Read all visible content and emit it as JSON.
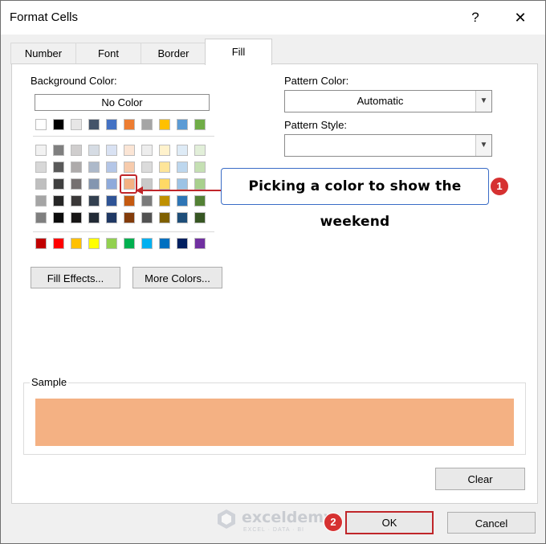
{
  "dialog": {
    "title": "Format Cells",
    "help_label": "?",
    "close_label": "✕"
  },
  "tabs": [
    {
      "label": "Number",
      "active": false
    },
    {
      "label": "Font",
      "active": false
    },
    {
      "label": "Border",
      "active": false
    },
    {
      "label": "Fill",
      "active": true
    }
  ],
  "fill": {
    "background_color_label": "Background Color:",
    "no_color_label": "No Color",
    "theme_top_row": [
      "#ffffff",
      "#000000",
      "#e7e6e6",
      "#44546a",
      "#4472c4",
      "#ed7d31",
      "#a5a5a5",
      "#ffc000",
      "#5b9bd5",
      "#70ad47"
    ],
    "theme_shades": [
      [
        "#f2f2f2",
        "#7f7f7f",
        "#d0cece",
        "#d6dce4",
        "#d9e2f3",
        "#fbe5d5",
        "#ededed",
        "#fff2cc",
        "#deebf6",
        "#e2efd9"
      ],
      [
        "#d8d8d8",
        "#595959",
        "#aeabab",
        "#adb9ca",
        "#b4c6e7",
        "#f7cbac",
        "#dbdbdb",
        "#fee599",
        "#bdd7ee",
        "#c5e0b3"
      ],
      [
        "#bfbfbf",
        "#3f3f3f",
        "#757070",
        "#8496b0",
        "#8eaadb",
        "#f4b183",
        "#c9c9c9",
        "#ffd965",
        "#9cc3e5",
        "#a8d08d"
      ],
      [
        "#a5a5a5",
        "#262626",
        "#3a3838",
        "#323f4f",
        "#2f5496",
        "#c55a11",
        "#7b7b7b",
        "#bf9000",
        "#2e75b5",
        "#538135"
      ],
      [
        "#7f7f7f",
        "#0c0c0c",
        "#171616",
        "#222a35",
        "#1f3864",
        "#833c0b",
        "#525252",
        "#7f6000",
        "#1e4e79",
        "#375623"
      ]
    ],
    "standard_colors": [
      "#c00000",
      "#ff0000",
      "#ffc000",
      "#ffff00",
      "#92d050",
      "#00b050",
      "#00b0f0",
      "#0070c0",
      "#002060",
      "#7030a0"
    ],
    "selected_color": "#f4b183",
    "fill_effects_label": "Fill Effects...",
    "more_colors_label": "More Colors...",
    "pattern_color_label": "Pattern Color:",
    "pattern_color_value": "Automatic",
    "pattern_style_label": "Pattern Style:",
    "pattern_style_value": "",
    "sample_label": "Sample",
    "clear_label": "Clear"
  },
  "footer": {
    "ok_label": "OK",
    "cancel_label": "Cancel"
  },
  "annotations": {
    "callout_text": "Picking a color to show the weekend",
    "step1": "1",
    "step2": "2",
    "accent_color": "#c0262a"
  },
  "watermark": {
    "name": "exceldemy",
    "tagline": "EXCEL · DATA · BI"
  }
}
